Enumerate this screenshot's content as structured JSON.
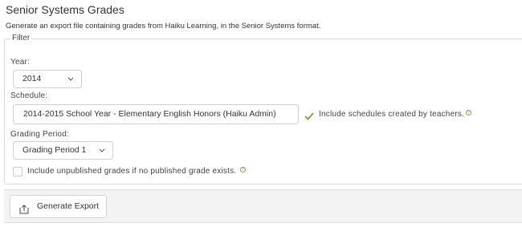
{
  "page": {
    "title": "Senior Systems Grades",
    "description": "Generate an export file containing grades from Haiku Learning, in the Senior Systems format."
  },
  "filter": {
    "legend": "Filter",
    "year": {
      "label": "Year:",
      "value": "2014"
    },
    "schedule": {
      "label": "Schedule:",
      "value": "2014-2015 School Year - Elementary English Honors (Haiku Admin)",
      "include_teacher_schedules": {
        "label": "Include schedules created by teachers.",
        "checked": true
      }
    },
    "grading_period": {
      "label": "Grading Period:",
      "value": "Grading Period 1"
    },
    "include_unpublished": {
      "label": "Include unpublished grades if no published grade exists.",
      "checked": false
    }
  },
  "actions": {
    "generate_export_label": "Generate Export"
  },
  "icons": {
    "help": "help-icon",
    "check": "checkmark-icon",
    "export": "export-icon",
    "chevron": "chevron-down-icon"
  },
  "colors": {
    "accent_green": "#7aa64d",
    "border": "#d8d8d8",
    "footer_bg": "#f3f3f3"
  }
}
